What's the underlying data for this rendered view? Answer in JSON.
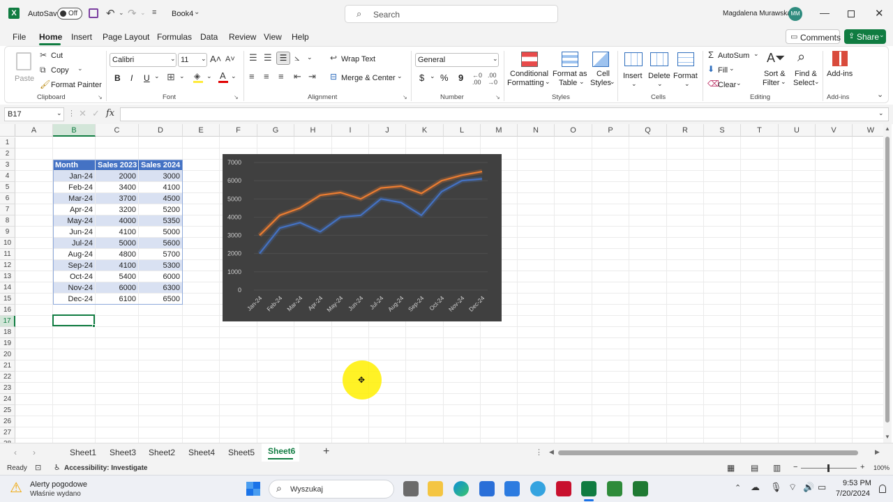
{
  "titlebar": {
    "autosave_label": "AutoSave",
    "autosave_state": "Off",
    "doc_name": "Book4",
    "search_placeholder": "Search",
    "user_name": "Magdalena Murawska",
    "user_initials": "MM"
  },
  "menu": {
    "tabs": [
      "File",
      "Home",
      "Insert",
      "Page Layout",
      "Formulas",
      "Data",
      "Review",
      "View",
      "Help"
    ],
    "active": "Home",
    "comments_label": "Comments",
    "share_label": "Share"
  },
  "ribbon": {
    "clipboard": {
      "paste": "Paste",
      "cut": "Cut",
      "copy": "Copy",
      "format_painter": "Format Painter",
      "label": "Clipboard"
    },
    "font": {
      "font_name": "Calibri",
      "font_size": "11",
      "bold": "B",
      "italic": "I",
      "underline": "U",
      "label": "Font"
    },
    "alignment": {
      "wrap_text": "Wrap Text",
      "merge_center": "Merge & Center",
      "label": "Alignment"
    },
    "number": {
      "format": "General",
      "currency": "$",
      "percent": "%",
      "comma": "9",
      "label": "Number"
    },
    "styles": {
      "conditional_1": "Conditional",
      "conditional_2": "Formatting",
      "format_table_1": "Format as",
      "format_table_2": "Table",
      "cell_styles_1": "Cell",
      "cell_styles_2": "Styles",
      "label": "Styles"
    },
    "cells": {
      "insert": "Insert",
      "delete": "Delete",
      "format": "Format",
      "label": "Cells"
    },
    "editing": {
      "autosum": "AutoSum",
      "fill": "Fill",
      "clear": "Clear",
      "sort_1": "Sort &",
      "sort_2": "Filter",
      "find_1": "Find &",
      "find_2": "Select",
      "label": "Editing"
    },
    "addins": {
      "addins": "Add-ins",
      "label": "Add-ins"
    }
  },
  "formula_bar": {
    "name_box": "B17",
    "fx": "fx",
    "value": ""
  },
  "grid": {
    "columns": [
      "A",
      "B",
      "C",
      "D",
      "E",
      "F",
      "G",
      "H",
      "I",
      "J",
      "K",
      "L",
      "M",
      "N",
      "O",
      "P",
      "Q",
      "R",
      "S",
      "T",
      "U",
      "V",
      "W"
    ],
    "rows": [
      "1",
      "2",
      "3",
      "4",
      "5",
      "6",
      "7",
      "8",
      "9",
      "10",
      "11",
      "12",
      "13",
      "14",
      "15",
      "16",
      "17",
      "18",
      "19",
      "20",
      "21",
      "22",
      "23",
      "24",
      "25",
      "26",
      "27",
      "28"
    ],
    "table_headers": [
      "Month",
      "Sales 2023",
      "Sales 2024"
    ],
    "table_rows": [
      [
        "Jan-24",
        "2000",
        "3000"
      ],
      [
        "Feb-24",
        "3400",
        "4100"
      ],
      [
        "Mar-24",
        "3700",
        "4500"
      ],
      [
        "Apr-24",
        "3200",
        "5200"
      ],
      [
        "May-24",
        "4000",
        "5350"
      ],
      [
        "Jun-24",
        "4100",
        "5000"
      ],
      [
        "Jul-24",
        "5000",
        "5600"
      ],
      [
        "Aug-24",
        "4800",
        "5700"
      ],
      [
        "Sep-24",
        "4100",
        "5300"
      ],
      [
        "Oct-24",
        "5400",
        "6000"
      ],
      [
        "Nov-24",
        "6000",
        "6300"
      ],
      [
        "Dec-24",
        "6100",
        "6500"
      ]
    ]
  },
  "chart_data": {
    "type": "line",
    "categories": [
      "Jan-24",
      "Feb-24",
      "Mar-24",
      "Apr-24",
      "May-24",
      "Jun-24",
      "Jul-24",
      "Aug-24",
      "Sep-24",
      "Oct-24",
      "Nov-24",
      "Dec-24"
    ],
    "series": [
      {
        "values": [
          2000,
          3400,
          3700,
          3200,
          4000,
          4100,
          5000,
          4800,
          4100,
          5400,
          6000,
          6100
        ],
        "color": "#4472c4"
      },
      {
        "values": [
          3000,
          4100,
          4500,
          5200,
          5350,
          5000,
          5600,
          5700,
          5300,
          6000,
          6300,
          6500
        ],
        "color": "#ed7d31"
      }
    ],
    "yticks": [
      "0",
      "1000",
      "2000",
      "3000",
      "4000",
      "5000",
      "6000",
      "7000"
    ],
    "ylim": [
      0,
      7000
    ],
    "background": "#404040",
    "grid": true
  },
  "sheets": {
    "tabs": [
      "Sheet1",
      "Sheet3",
      "Sheet2",
      "Sheet4",
      "Sheet5",
      "Sheet6"
    ],
    "active": "Sheet6",
    "add": "+"
  },
  "status": {
    "ready": "Ready",
    "accessibility": "Accessibility: Investigate",
    "zoom": "100%"
  },
  "taskbar": {
    "weather_title": "Alerty pogodowe",
    "weather_sub": "Właśnie wydano",
    "search_placeholder": "Wyszukaj",
    "time": "9:53 PM",
    "date": "7/20/2024"
  },
  "colors": {
    "excel_green": "#107c41",
    "table_header": "#4472c4",
    "table_band": "#d9e1f2",
    "chart_bg": "#404040"
  }
}
